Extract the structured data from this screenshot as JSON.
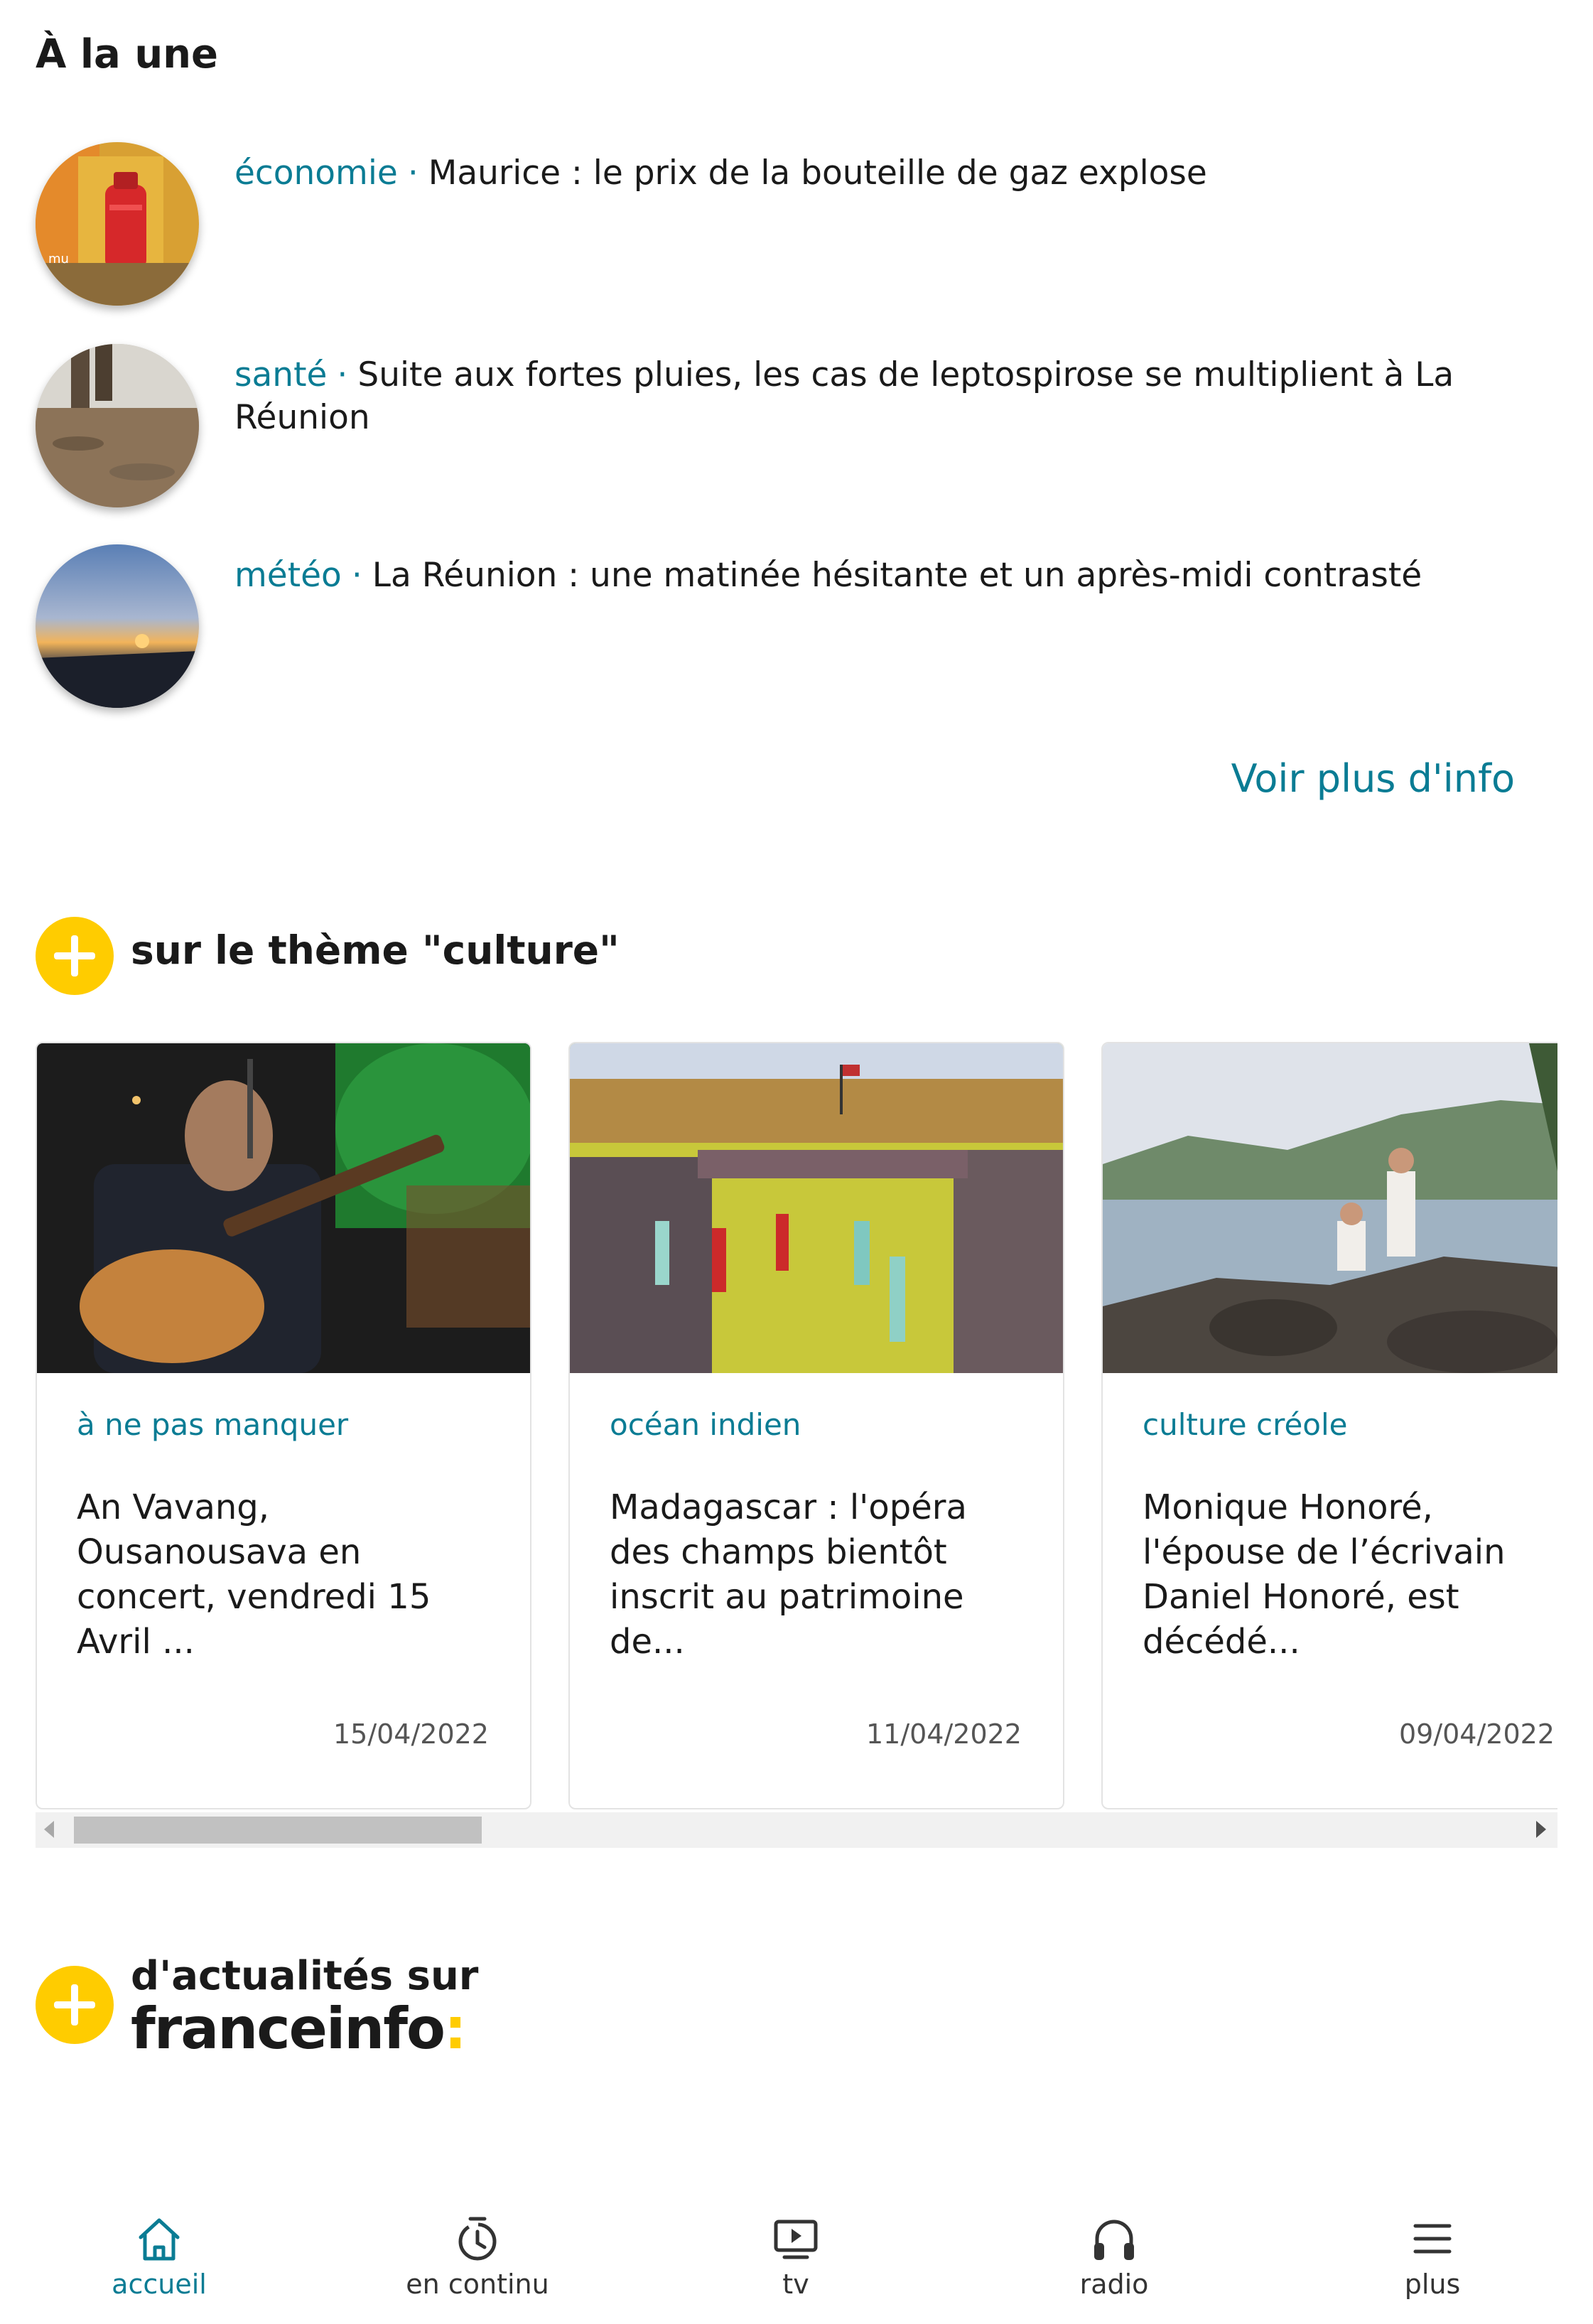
{
  "a_la_une": {
    "title": "À la une",
    "items": [
      {
        "category": "économie",
        "separator": "·",
        "headline": "Maurice : le prix de la bouteille de gaz explose",
        "thumb_caption": "mu"
      },
      {
        "category": "santé",
        "separator": "·",
        "headline": "Suite aux fortes pluies, les cas de leptospirose se multiplient à La Réunion"
      },
      {
        "category": "météo",
        "separator": "·",
        "headline": "La Réunion : une matinée hésitante et un après-midi contrasté"
      }
    ],
    "more_link": "Voir plus d'info"
  },
  "culture": {
    "title": "sur le thème \"culture\"",
    "cards": [
      {
        "category": "à ne pas manquer",
        "title": "An Vavang, Ousanousava en concert, vendredi 15 Avril ...",
        "date": "15/04/2022"
      },
      {
        "category": "océan indien",
        "title": "Madagascar : l'opéra des champs bientôt inscrit au patrimoine de...",
        "date": "11/04/2022"
      },
      {
        "category": "culture créole",
        "title": "Monique Honoré, l'épouse de l’écrivain Daniel Honoré, est décédé...",
        "date": "09/04/2022"
      }
    ]
  },
  "actualites": {
    "title": "d'actualités sur",
    "logo_text": "franceinfo",
    "logo_colon": ":"
  },
  "bottom_nav": {
    "items": [
      {
        "label": "accueil",
        "icon": "home-icon",
        "active": true
      },
      {
        "label": "en continu",
        "icon": "timer-icon",
        "active": false
      },
      {
        "label": "tv",
        "icon": "tv-play-icon",
        "active": false
      },
      {
        "label": "radio",
        "icon": "headphones-icon",
        "active": false
      },
      {
        "label": "plus",
        "icon": "menu-icon",
        "active": false
      }
    ]
  },
  "colors": {
    "accent": "#0a7c94",
    "brand_yellow": "#ffcc00",
    "text": "#1a1a1a"
  }
}
